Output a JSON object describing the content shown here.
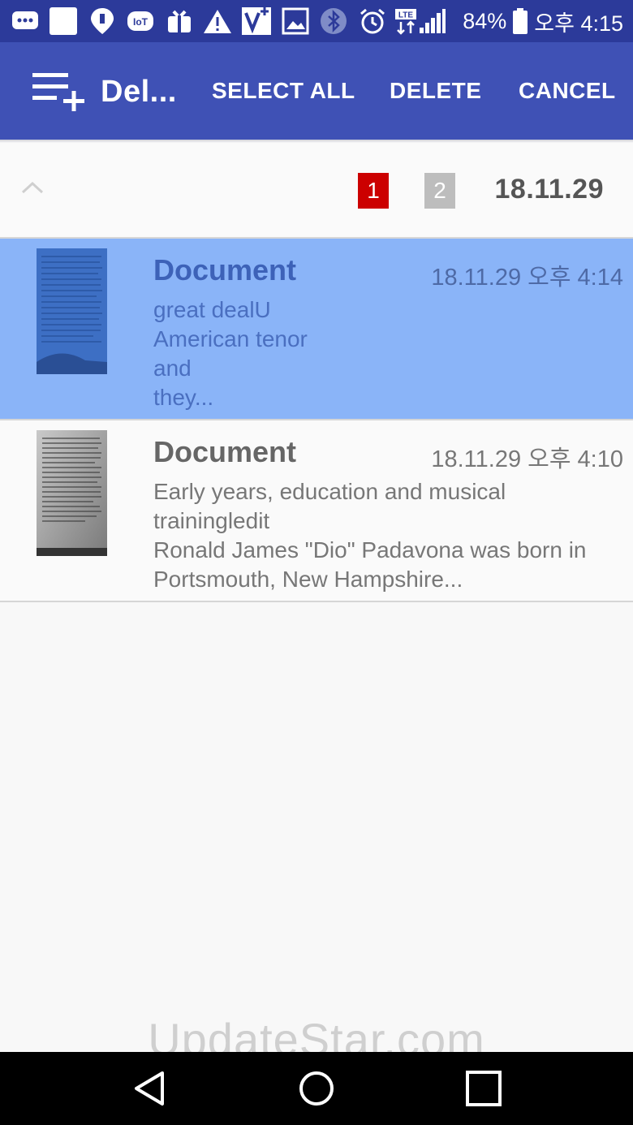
{
  "status_bar": {
    "icons": [
      "chat-icon",
      "square-icon",
      "location-shield-icon",
      "iot-icon",
      "gift-icon",
      "warning-icon",
      "vpn-icon",
      "image-icon",
      "bluetooth-icon",
      "alarm-icon",
      "lte-icon",
      "signal-icon"
    ],
    "iot_label": "IoT",
    "lte_label": "LTE",
    "battery": "84%",
    "battery_icon": "battery-icon",
    "time": "오후 4:15",
    "background": "#2c3a9a"
  },
  "app_bar": {
    "icon": "playlist-add-icon",
    "title": "Del...",
    "select_all": "SELECT ALL",
    "delete": "DELETE",
    "cancel": "CANCEL",
    "background": "#3f51b5"
  },
  "group": {
    "collapse_icon": "chevron-up-icon",
    "pages": [
      "1",
      "2"
    ],
    "active_page_color": "#cc0000",
    "date": "18.11.29"
  },
  "documents": [
    {
      "title": "Document",
      "time": "18.11.29 오후 4:14",
      "preview_lines": [
        "great dealU",
        "American tenor",
        "and",
        "they..."
      ],
      "selected": true,
      "thumbnail_icon": "document-thumbnail-icon"
    },
    {
      "title": "Document",
      "time": "18.11.29 오후 4:10",
      "preview_lines": [
        "Early years, education and musical",
        "trainingledit",
        "Ronald James \"Dio\" Padavona was born in",
        "Portsmouth, New Hampshire..."
      ],
      "selected": false,
      "thumbnail_icon": "document-thumbnail-icon"
    }
  ],
  "selection_color": "#8ab4f8",
  "watermark": "UpdateStar.com",
  "nav_bar": {
    "back_icon": "back-icon",
    "home_icon": "home-icon",
    "recents_icon": "recents-icon"
  }
}
